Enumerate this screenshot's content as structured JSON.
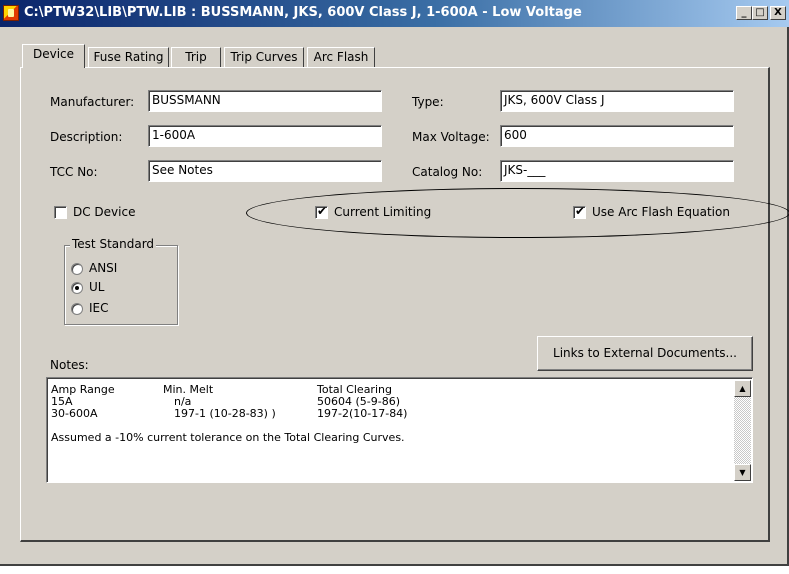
{
  "window": {
    "title": "C:\\PTW32\\LIB\\PTW.LIB : BUSSMANN, JKS, 600V Class J, 1-600A - Low Voltage",
    "controls": {
      "minimize": "_",
      "maximize": "□",
      "close": "X"
    }
  },
  "tabs": [
    "Device",
    "Fuse Rating",
    "Trip",
    "Trip Curves",
    "Arc Flash"
  ],
  "active_tab": "Device",
  "fields": {
    "manufacturer": {
      "label": "Manufacturer:",
      "value": "BUSSMANN"
    },
    "description": {
      "label": "Description:",
      "value": "1-600A"
    },
    "tcc_no": {
      "label": "TCC No:",
      "value": "See Notes"
    },
    "type": {
      "label": "Type:",
      "value": "JKS, 600V Class J"
    },
    "max_voltage": {
      "label": "Max Voltage:",
      "value": "600"
    },
    "catalog_no": {
      "label": "Catalog No:",
      "value": "JKS-___"
    }
  },
  "checkboxes": {
    "dc_device": {
      "label": "DC Device",
      "checked": false
    },
    "current_limiting": {
      "label": "Current Limiting",
      "checked": true
    },
    "use_arc_flash": {
      "label": "Use Arc Flash Equation",
      "checked": true
    }
  },
  "check_mark": "✔",
  "test_standard": {
    "title": "Test Standard",
    "options": [
      "ANSI",
      "UL",
      "IEC"
    ],
    "selected": "UL"
  },
  "notes": {
    "label": "Notes:",
    "header": {
      "col1": "Amp Range",
      "col2": "Min. Melt",
      "col3": "Total Clearing"
    },
    "rows": [
      {
        "range": "15A",
        "min_melt": "n/a",
        "total": "50604 (5-9-86)"
      },
      {
        "range": "30-600A",
        "min_melt": "197-1 (10-28-83) )",
        "total": "197-2(10-17-84)"
      }
    ],
    "footer": "Assumed a -10% current tolerance on the Total Clearing Curves."
  },
  "links_button": "Links to External Documents...",
  "scroll": {
    "up": "▲",
    "down": "▼"
  },
  "icons": {
    "app": "ptw-app-icon",
    "scroll_up": "arrow-up-icon",
    "scroll_down": "arrow-down-icon"
  }
}
